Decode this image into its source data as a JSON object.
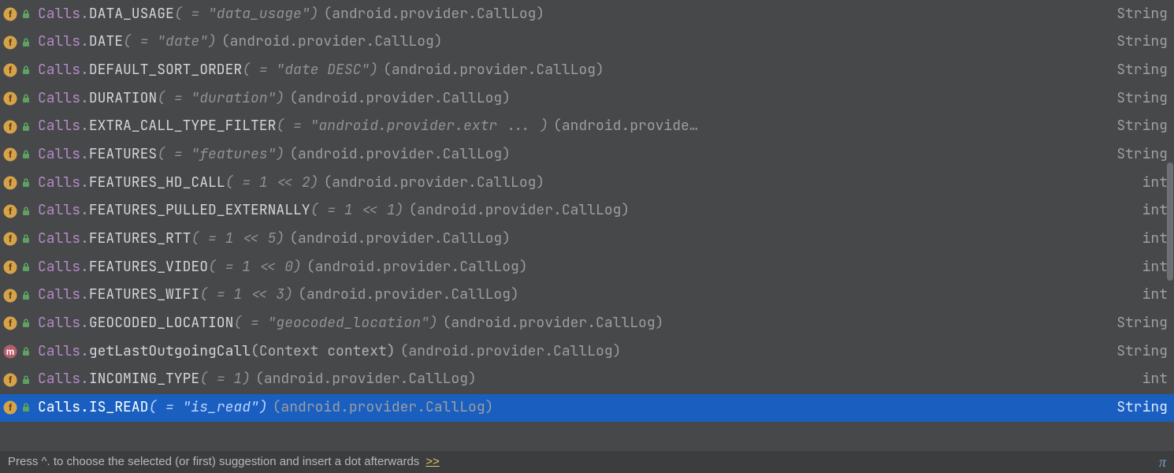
{
  "footer": {
    "hint": "Press ^. to choose the selected (or first) suggestion and insert a dot afterwards",
    "more": ">>",
    "pi": "π"
  },
  "items": [
    {
      "kind": "f",
      "qual": "Calls.",
      "member": "DATA_USAGE",
      "value": "( = \"data_usage\")",
      "pkg": "(android.provider.CallLog)",
      "type": "String",
      "selected": false
    },
    {
      "kind": "f",
      "qual": "Calls.",
      "member": "DATE",
      "value": "( = \"date\")",
      "pkg": "(android.provider.CallLog)",
      "type": "String",
      "selected": false
    },
    {
      "kind": "f",
      "qual": "Calls.",
      "member": "DEFAULT_SORT_ORDER",
      "value": "( = \"date DESC\")",
      "pkg": "(android.provider.CallLog)",
      "type": "String",
      "selected": false
    },
    {
      "kind": "f",
      "qual": "Calls.",
      "member": "DURATION",
      "value": "( = \"duration\")",
      "pkg": "(android.provider.CallLog)",
      "type": "String",
      "selected": false
    },
    {
      "kind": "f",
      "qual": "Calls.",
      "member": "EXTRA_CALL_TYPE_FILTER",
      "value": "( = \"android.provider.extr ... )",
      "pkg": "(android.provide…",
      "type": "String",
      "selected": false
    },
    {
      "kind": "f",
      "qual": "Calls.",
      "member": "FEATURES",
      "value": "( = \"features\")",
      "pkg": "(android.provider.CallLog)",
      "type": "String",
      "selected": false
    },
    {
      "kind": "f",
      "qual": "Calls.",
      "member": "FEATURES_HD_CALL",
      "value": "( = 1 << 2)",
      "pkg": "(android.provider.CallLog)",
      "type": "int",
      "selected": false
    },
    {
      "kind": "f",
      "qual": "Calls.",
      "member": "FEATURES_PULLED_EXTERNALLY",
      "value": "( = 1 << 1)",
      "pkg": "(android.provider.CallLog)",
      "type": "int",
      "selected": false
    },
    {
      "kind": "f",
      "qual": "Calls.",
      "member": "FEATURES_RTT",
      "value": "( = 1 << 5)",
      "pkg": "(android.provider.CallLog)",
      "type": "int",
      "selected": false
    },
    {
      "kind": "f",
      "qual": "Calls.",
      "member": "FEATURES_VIDEO",
      "value": "( = 1 << 0)",
      "pkg": "(android.provider.CallLog)",
      "type": "int",
      "selected": false
    },
    {
      "kind": "f",
      "qual": "Calls.",
      "member": "FEATURES_WIFI",
      "value": "( = 1 << 3)",
      "pkg": "(android.provider.CallLog)",
      "type": "int",
      "selected": false
    },
    {
      "kind": "f",
      "qual": "Calls.",
      "member": "GEOCODED_LOCATION",
      "value": "( = \"geocoded_location\")",
      "pkg": "(android.provider.CallLog)",
      "type": "String",
      "selected": false
    },
    {
      "kind": "m",
      "qual": "Calls.",
      "member": "getLastOutgoingCall",
      "params": "(Context context)",
      "pkg": "(android.provider.CallLog)",
      "type": "String",
      "selected": false
    },
    {
      "kind": "f",
      "qual": "Calls.",
      "member": "INCOMING_TYPE",
      "value": "( = 1)",
      "pkg": "(android.provider.CallLog)",
      "type": "int",
      "selected": false
    },
    {
      "kind": "f",
      "qual": "Calls.",
      "member": "IS_READ",
      "value": "( = \"is_read\")",
      "pkg": "(android.provider.CallLog)",
      "type": "String",
      "selected": true
    }
  ]
}
